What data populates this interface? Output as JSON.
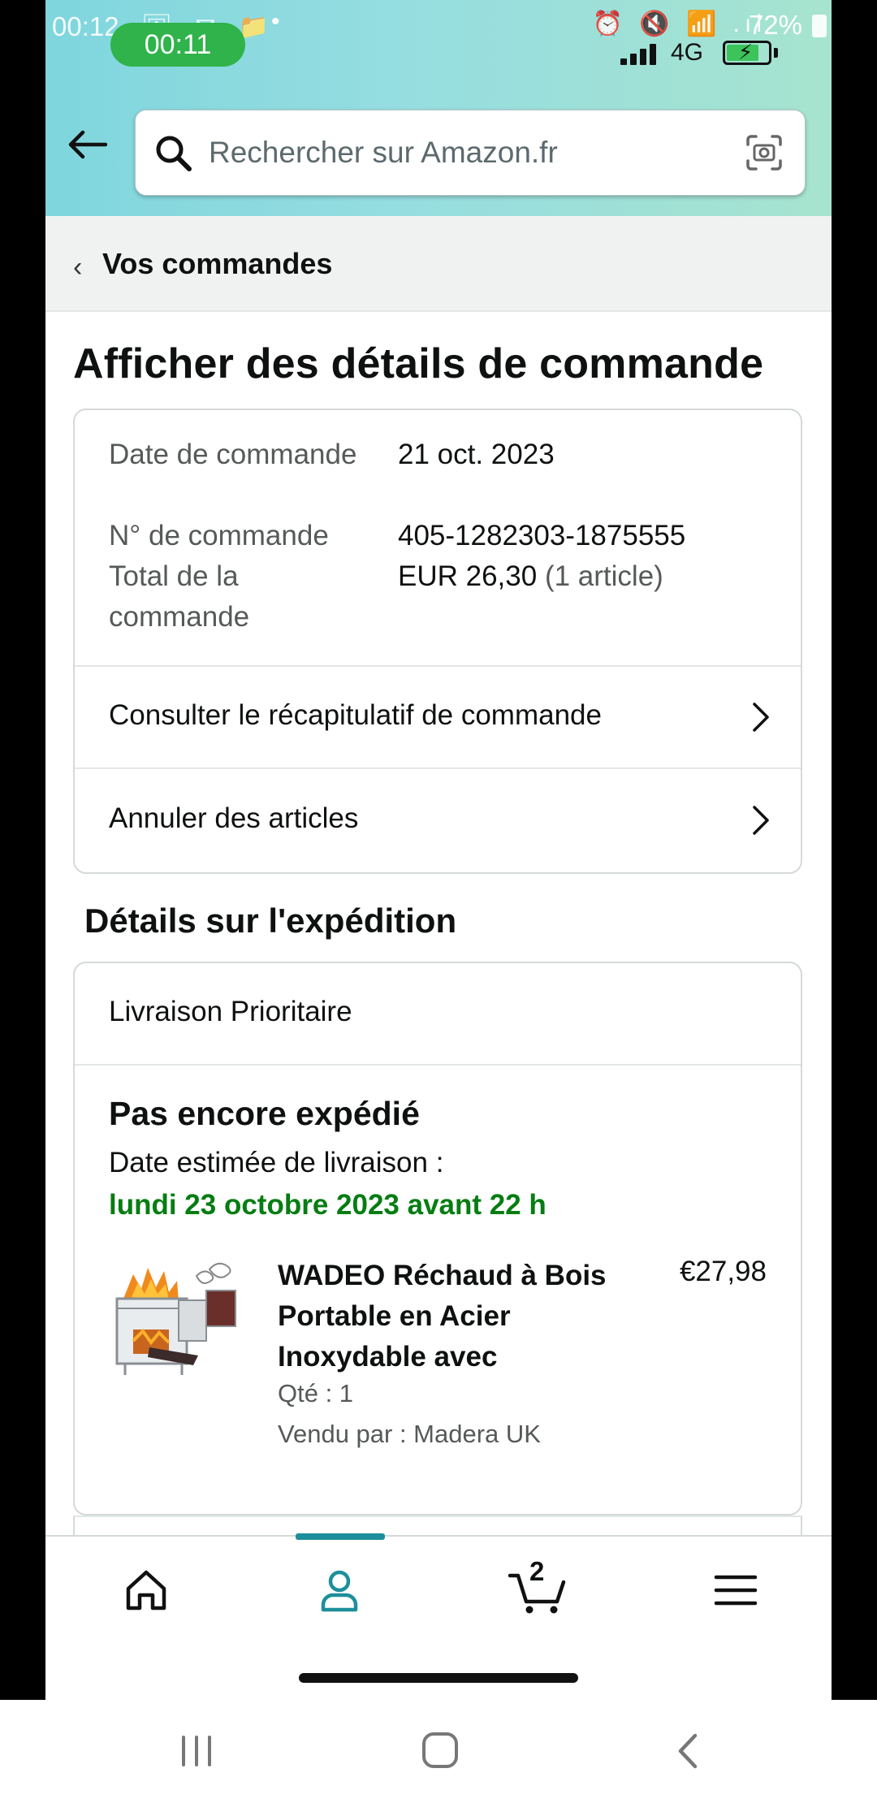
{
  "status_bar": {
    "time": "00:12",
    "call_timer": "00:11",
    "network": "4G",
    "battery_percent": "72%",
    "left_icons": "🖼 ✉ 📁",
    "right_icons": "⏰ 🔇 📶 .ıl"
  },
  "header": {
    "search_placeholder": "Rechercher sur Amazon.fr"
  },
  "breadcrumb": {
    "label": "Vos commandes"
  },
  "page": {
    "title": "Afficher des détails de commande"
  },
  "order_summary": {
    "date_label": "Date de commande",
    "date_value": "21 oct. 2023",
    "number_label": "N° de commande",
    "number_value": "405-1282303-1875555",
    "total_label": "Total de la commande",
    "total_value": "EUR 26,30",
    "total_items": "(1 article)"
  },
  "links": {
    "view_summary": "Consulter le récapitulatif de commande",
    "cancel_items": "Annuler des articles"
  },
  "shipment": {
    "section_title": "Détails sur l'expédition",
    "method": "Livraison Prioritaire",
    "status": "Pas encore expédié",
    "estimate_label": "Date estimée de livraison :",
    "estimate_date": "lundi 23 octobre 2023 avant 22 h"
  },
  "product": {
    "title": "WADEO Réchaud à Bois Portable en Acier Inoxydable avec",
    "price": "€27,98",
    "quantity": "Qté : 1",
    "seller": "Vendu par : Madera UK"
  },
  "bottom_nav": {
    "cart_count": "2",
    "active_tab": "account"
  },
  "colors": {
    "accent": "#1d8f9c",
    "delivery_green": "#067d12",
    "call_pill": "#2fb34a"
  }
}
